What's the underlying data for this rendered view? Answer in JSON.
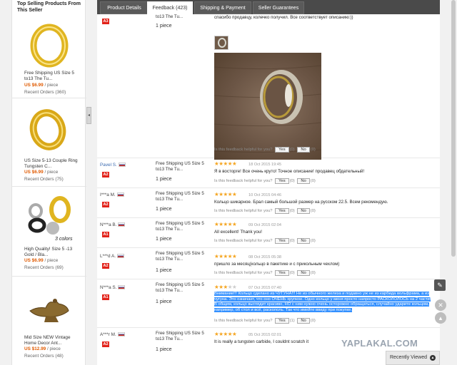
{
  "sidebar": {
    "title": "Top Selling Products From This Seller",
    "products": [
      {
        "title": "Free Shipping US Size 5 to13 The Tu...",
        "price": "US $6.99",
        "unit": "/ piece",
        "orders": "Recent Orders (360)"
      },
      {
        "title": "US Size 5-13 Couple Ring Tungsten C...",
        "price": "US $6.99",
        "unit": "/ piece",
        "orders": "Recent Orders (75)"
      },
      {
        "title": "High Quality! Size 5 -13 Gold / Bla...",
        "price": "US $6.99",
        "unit": "/ piece",
        "orders": "Recent Orders (69)",
        "badge": "3 colors"
      },
      {
        "title": "Mid Size NEW Vintage Home Decor Ant...",
        "price": "US $12.99",
        "unit": "/ piece",
        "orders": "Recent Orders (48)"
      }
    ]
  },
  "tabs": [
    {
      "label": "Product Details"
    },
    {
      "label": "Feedback (423)"
    },
    {
      "label": "Shipping & Payment"
    },
    {
      "label": "Seller Guarantees"
    }
  ],
  "helpful": {
    "question": "Is this feedback helpful for you?",
    "yes": "Yes",
    "no": "No"
  },
  "feedback": [
    {
      "buyer": "",
      "level": "A3",
      "product": "to13 The Tu...",
      "qty": "1 piece",
      "stars": 5,
      "date": "",
      "comment": "спасибо продавцу, колечко получил. Все соответствует описанию:))",
      "yes_count": "(0)",
      "no_count": "(0)"
    },
    {
      "buyer": "Pavel S.",
      "level": "A2",
      "product": "Free Shipping US Size 5 to13 The Tu...",
      "qty": "1 piece",
      "stars": 5,
      "date": "18 Oct 2015 19:45",
      "comment": "Я в восторге! Все очень круто! Точное описание! продавец обдательный!",
      "yes_count": "(0)",
      "no_count": "(0)"
    },
    {
      "buyer": "I***a M.",
      "level": "A2",
      "product": "Free Shipping US Size 5 to13 The Tu...",
      "qty": "1 piece",
      "stars": 5,
      "date": "10 Oct 2015 04:46",
      "comment": "Кольцо шикарное. Брал самый большой размер на русском 22.5. Всем рекомендую.",
      "yes_count": "(0)",
      "no_count": "(0)"
    },
    {
      "buyer": "N***a B.",
      "level": "A1",
      "product": "Free Shipping US Size 5 to13 The Tu...",
      "qty": "1 piece",
      "stars": 5,
      "date": "09 Oct 2015 02:04",
      "comment": "All excellent! Thank you!",
      "yes_count": "(0)",
      "no_count": "(0)"
    },
    {
      "buyer": "L***d A.",
      "level": "A2",
      "product": "Free Shipping US Size 5 to13 The Tu...",
      "qty": "1 piece",
      "stars": 5,
      "date": "08 Oct 2015 05:38",
      "comment": "пришло за месяц(кольцо в пакетике и с прикольным чехлом)",
      "yes_count": "(0)",
      "no_count": "(0)"
    },
    {
      "buyer": "N***a S.",
      "level": "A1",
      "product": "Free Shipping US Size 5 to13 The Tu...",
      "qty": "1 piece",
      "stars": 3,
      "date": "07 Oct 2015 07:40",
      "comment": "Внимание!!! Кольцо сделано из ЧУГУНА!!! Не из обычного железа и подавно уж не из карбида вольфрама, а из чугуна. Это означает, что оно ОЧЕНЬ хрупкое. Одно кольцо у меня просто напросто РАСКОЛОЛОСЬ на 2 части! В общем, кольцо выглядит красиво, НО с ним нужно очень осторожно обращаться, случайно ударите кольцом, например, об стол и всё, раскололь. Так что имейте ввиду при покупке.",
      "yes_count": "(1)",
      "no_count": "(0)"
    },
    {
      "buyer": "A***r M.",
      "level": "A2",
      "product": "Free Shipping US Size 5 to13 The Tu...",
      "qty": "1 piece",
      "stars": 5,
      "date": "05 Oct 2015 02:01",
      "comment": "It is really a tungsten carbide, I couldnt scratch it",
      "yes_count": "",
      "no_count": ""
    }
  ],
  "watermark": "YAPLAKAL.COM",
  "recently_viewed": "Recently Viewed",
  "colors": {
    "accent": "#e05a00",
    "tab_bar": "#4a4a4a",
    "level_badge": "#e2231a",
    "star": "#f5a623",
    "highlight": "#3390ff"
  }
}
